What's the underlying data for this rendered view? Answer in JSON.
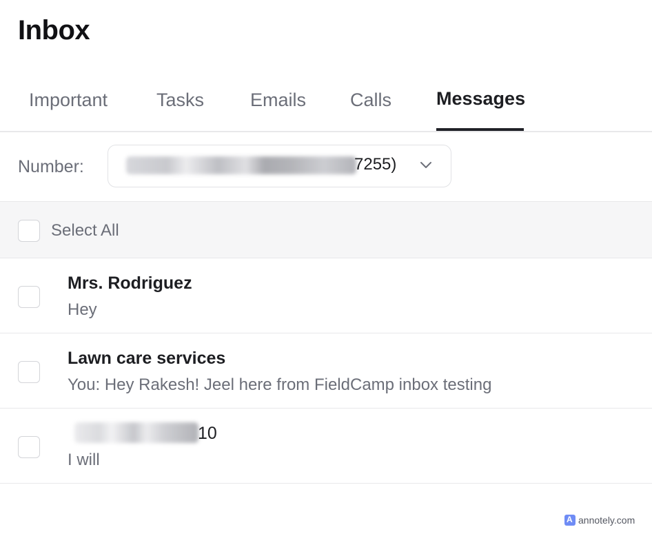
{
  "header": {
    "title": "Inbox"
  },
  "tabs": [
    {
      "label": "Important",
      "active": false
    },
    {
      "label": "Tasks",
      "active": false
    },
    {
      "label": "Emails",
      "active": false
    },
    {
      "label": "Calls",
      "active": false
    },
    {
      "label": "Messages",
      "active": true
    }
  ],
  "number_filter": {
    "label": "Number:",
    "selected_value_visible_suffix": "7255)",
    "icon": "chevron-down-icon"
  },
  "select_all": {
    "label": "Select All",
    "checked": false
  },
  "conversations": [
    {
      "name": "Mrs. Rodriguez",
      "preview": "Hey",
      "checked": false
    },
    {
      "name": "Lawn care services",
      "preview": "You: Hey Rakesh! Jeel here from FieldCamp inbox testing",
      "checked": false
    },
    {
      "name_visible_suffix": "10",
      "preview": "I will",
      "checked": false
    }
  ],
  "watermark": {
    "text": "annotely.com"
  },
  "colors": {
    "accent_underline": "#202127",
    "muted_text": "#6b6e78",
    "divider": "#e8e8ea",
    "select_all_bg": "#f6f6f7"
  }
}
